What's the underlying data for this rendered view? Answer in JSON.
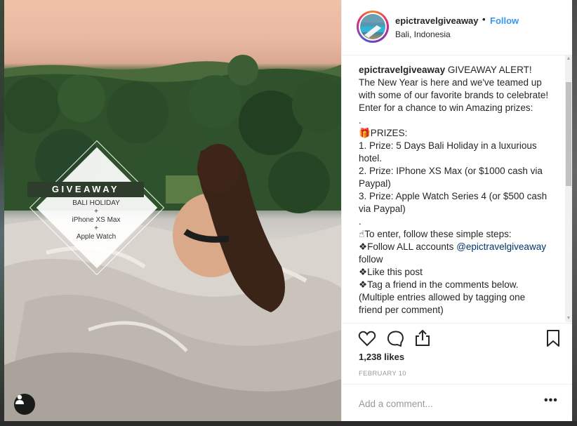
{
  "photo": {
    "overlay": {
      "title": "GIVEAWAY",
      "line1": "BALI HOLIDAY",
      "sep1": "+",
      "line2": "iPhone XS Max",
      "sep2": "+",
      "line3": "Apple Watch"
    },
    "user_tag_icon": "person-icon"
  },
  "header": {
    "username": "epictravelgiveaway",
    "dot": "•",
    "follow_label": "Follow",
    "location": "Bali, Indonesia"
  },
  "caption": {
    "username": "epictravelgiveaway",
    "intro": " GIVEAWAY ALERT! The New Year is here and we've teamed up with some of our favorite brands to celebrate! Enter for a chance to win Amazing prizes:",
    "dot1": ".",
    "prizes_heading": "🎁PRIZES:",
    "prize1": "1. Prize: 5 Days Bali Holiday in a luxurious hotel.",
    "prize2": "2. Prize: IPhone XS Max (or $1000 cash via Paypal)",
    "prize3": "3. Prize: Apple Watch Series 4 (or $500 cash via Paypal)",
    "dot2": ".",
    "steps_heading": "☝To enter, follow these simple steps:",
    "step1_prefix": "❖Follow ALL accounts ",
    "step1_mention": "@epictravelgiveaway",
    "step1_suffix": "follow",
    "step2": "❖Like this post",
    "step3": "❖Tag a friend in the comments below.",
    "note": "(Multiple entries allowed by tagging one friend per comment)"
  },
  "actions": {
    "like_icon": "heart-icon",
    "comment_icon": "comment-icon",
    "share_icon": "share-icon",
    "save_icon": "bookmark-icon"
  },
  "likes": "1,238 likes",
  "date": "FEBRUARY 10",
  "comment": {
    "placeholder": "Add a comment...",
    "more_label": "•••"
  },
  "colors": {
    "accent": "#3897f0",
    "mention": "#003569",
    "text": "#262626",
    "muted": "#999999"
  }
}
